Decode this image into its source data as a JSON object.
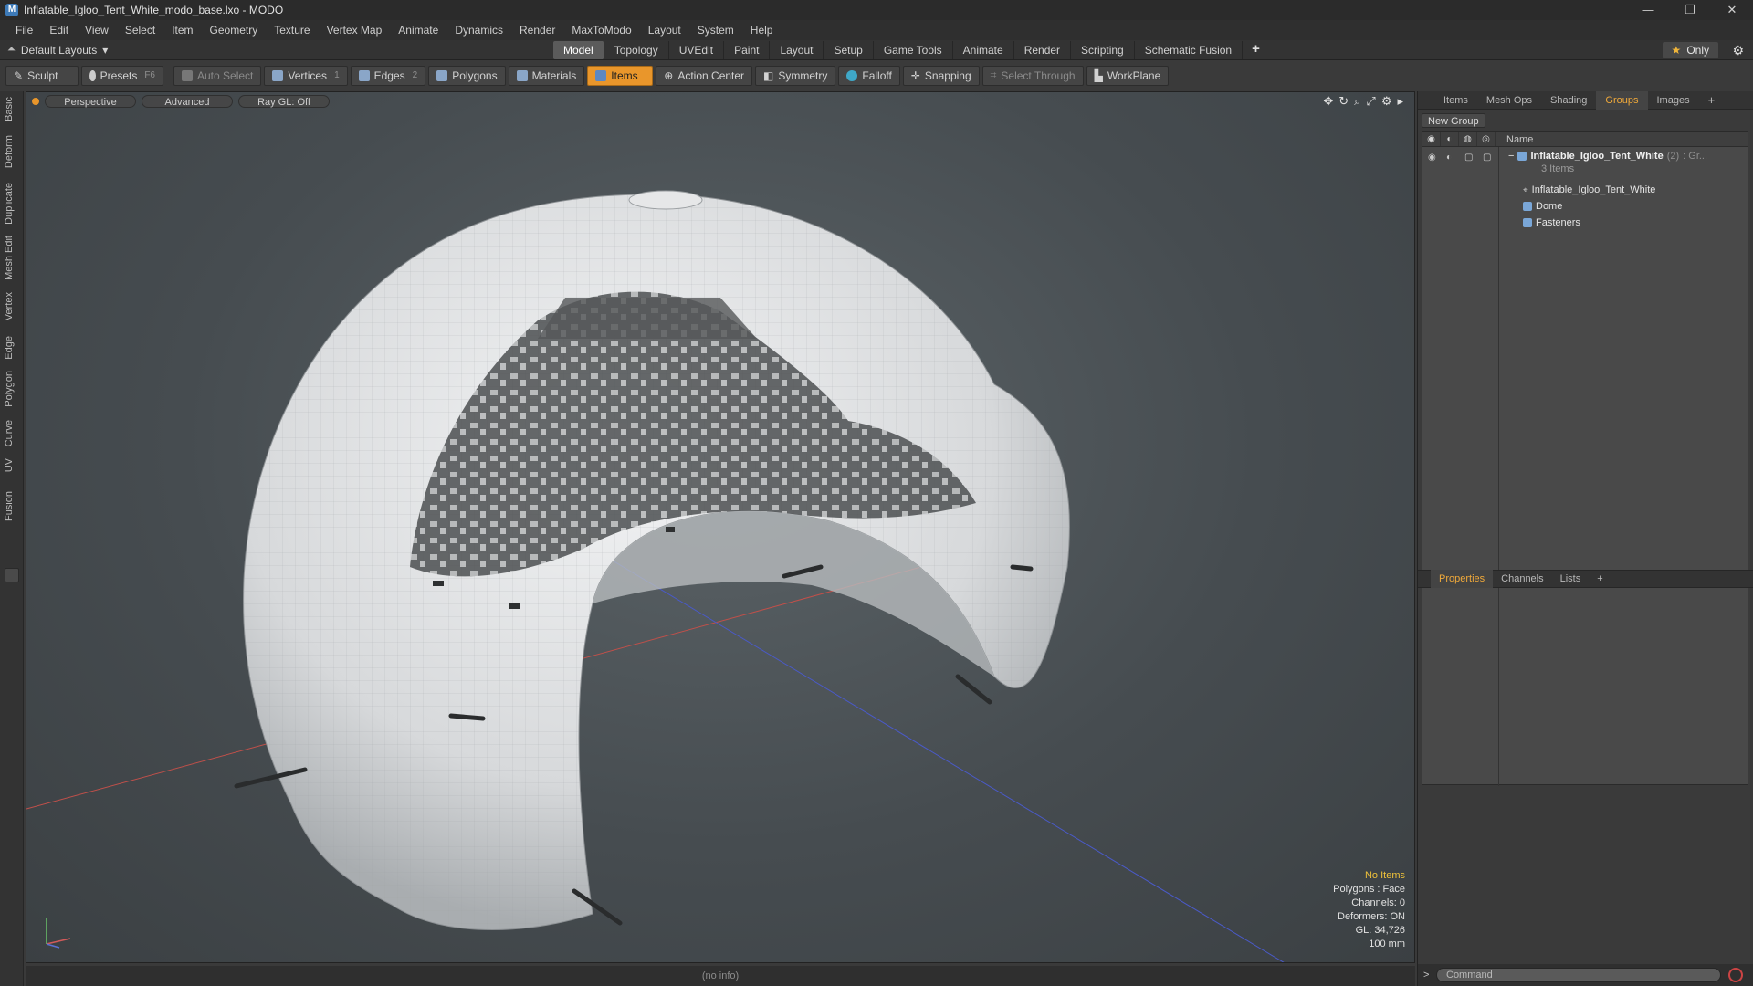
{
  "window": {
    "title": "Inflatable_Igloo_Tent_White_modo_base.lxo - MODO",
    "app_icon": "M",
    "controls": [
      "—",
      "❐",
      "✕"
    ]
  },
  "menu": [
    "File",
    "Edit",
    "View",
    "Select",
    "Item",
    "Geometry",
    "Texture",
    "Vertex Map",
    "Animate",
    "Dynamics",
    "Render",
    "MaxToModo",
    "Layout",
    "System",
    "Help"
  ],
  "layoutbar": {
    "layout_name": "Default Layouts",
    "tabs": [
      "Model",
      "Topology",
      "UVEdit",
      "Paint",
      "Layout",
      "Setup",
      "Game Tools",
      "Animate",
      "Render",
      "Scripting",
      "Schematic Fusion"
    ],
    "active_tab": "Model",
    "add_tab": "+",
    "only_label": "Only"
  },
  "toolbar": {
    "sculpt": "Sculpt",
    "presets": "Presets",
    "presets_key": "F6",
    "auto_select": "Auto Select",
    "vertices": "Vertices",
    "vertices_key": "1",
    "edges": "Edges",
    "edges_key": "2",
    "polygons": "Polygons",
    "materials": "Materials",
    "items": "Items",
    "action_center": "Action Center",
    "symmetry": "Symmetry",
    "falloff": "Falloff",
    "snapping": "Snapping",
    "select_through": "Select Through",
    "workplane": "WorkPlane"
  },
  "left_tabs": [
    "Basic",
    "Deform",
    "Duplicate",
    "Mesh Edit",
    "Vertex",
    "Edge",
    "Polygon",
    "Curve",
    "UV",
    "Fusion"
  ],
  "viewport": {
    "view": "Perspective",
    "shading": "Advanced",
    "raygl": "Ray GL: Off",
    "hud": {
      "selection": "No Items",
      "polygons": "Polygons : Face",
      "channels": "Channels: 0",
      "deformers": "Deformers: ON",
      "gl": "GL: 34,726",
      "unit": "100 mm"
    }
  },
  "status": "(no info)",
  "right_panel": {
    "tabs": [
      "Items",
      "Mesh Ops",
      "Shading",
      "Groups",
      "Images"
    ],
    "active_tab": "Groups",
    "new_group": "New Group",
    "name_header": "Name",
    "group": {
      "name": "Inflatable_Igloo_Tent_White",
      "count": "(2)",
      "suffix": ": Gr...",
      "items_label": "3 Items",
      "children": [
        "Inflatable_Igloo_Tent_White",
        "Dome",
        "Fasteners"
      ]
    },
    "props_tabs": [
      "Properties",
      "Channels",
      "Lists"
    ],
    "props_active": "Properties",
    "command_placeholder": "Command"
  }
}
